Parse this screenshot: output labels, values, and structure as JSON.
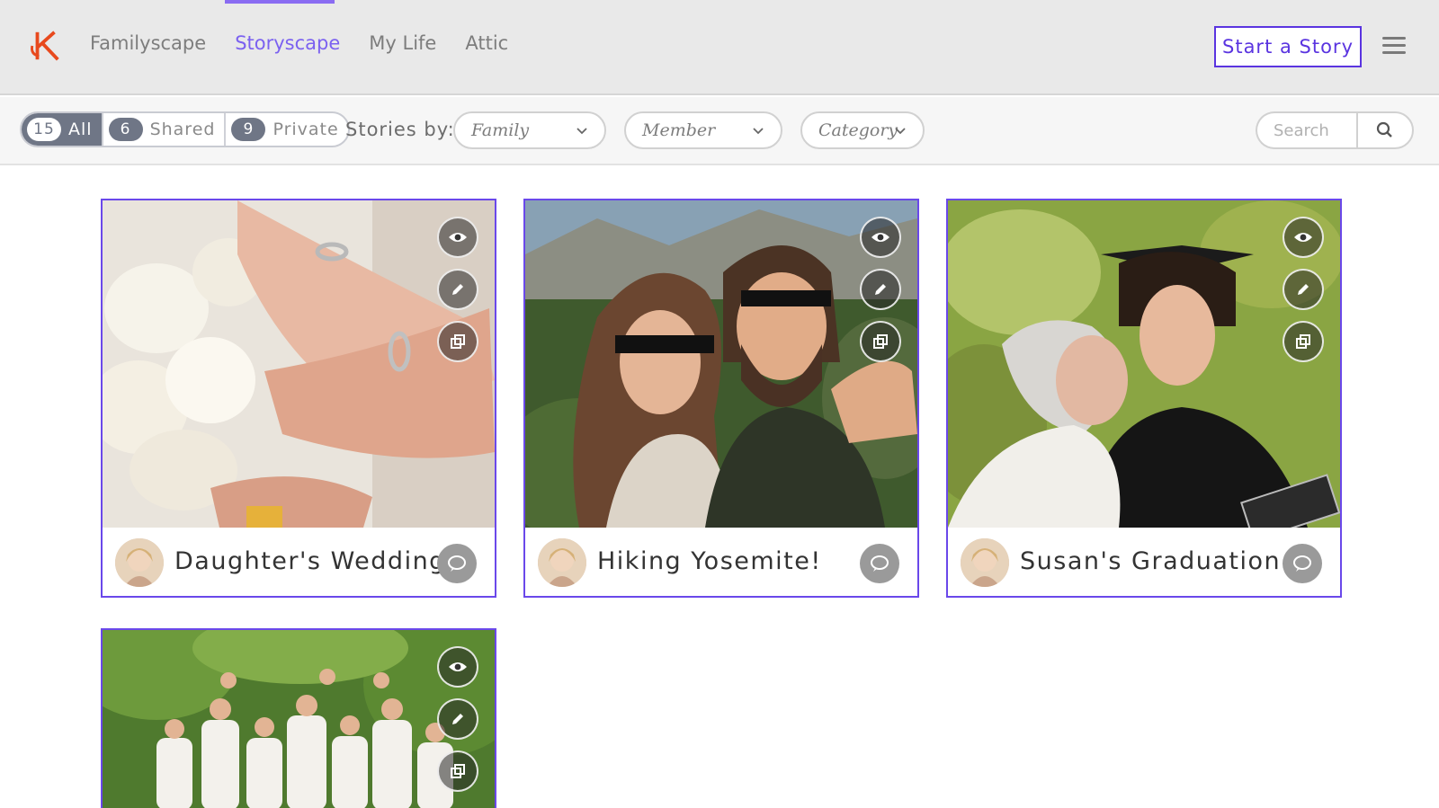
{
  "nav": {
    "items": [
      {
        "label": "Familyscape",
        "active": false
      },
      {
        "label": "Storyscape",
        "active": true
      },
      {
        "label": "My Life",
        "active": false
      },
      {
        "label": "Attic",
        "active": false
      }
    ],
    "start_button": "Start a Story"
  },
  "filters": {
    "segments": [
      {
        "count": "15",
        "label": "All",
        "active": true
      },
      {
        "count": "6",
        "label": "Shared",
        "active": false
      },
      {
        "count": "9",
        "label": "Private",
        "active": false
      }
    ],
    "stories_by_label": "Stories by:",
    "dropdowns": [
      "Family",
      "Member",
      "Category"
    ],
    "search_placeholder": "Search"
  },
  "stories": [
    {
      "title": "Daughter's Wedding",
      "photo": "wedding rings and white roses"
    },
    {
      "title": "Hiking Yosemite!",
      "photo": "couple selfie in mountains"
    },
    {
      "title": "Susan's Graduation",
      "photo": "graduate with grandmother"
    },
    {
      "title": "",
      "photo": "large family group outdoors"
    }
  ],
  "icons": {
    "view": "eye-icon",
    "edit": "pencil-icon",
    "copy": "copy-icon",
    "comment": "comment-icon",
    "search": "search-icon",
    "menu": "hamburger-menu-icon"
  },
  "colors": {
    "accent": "#7b61f0",
    "card_border": "#6a48ea",
    "logo": "#e8491d"
  }
}
